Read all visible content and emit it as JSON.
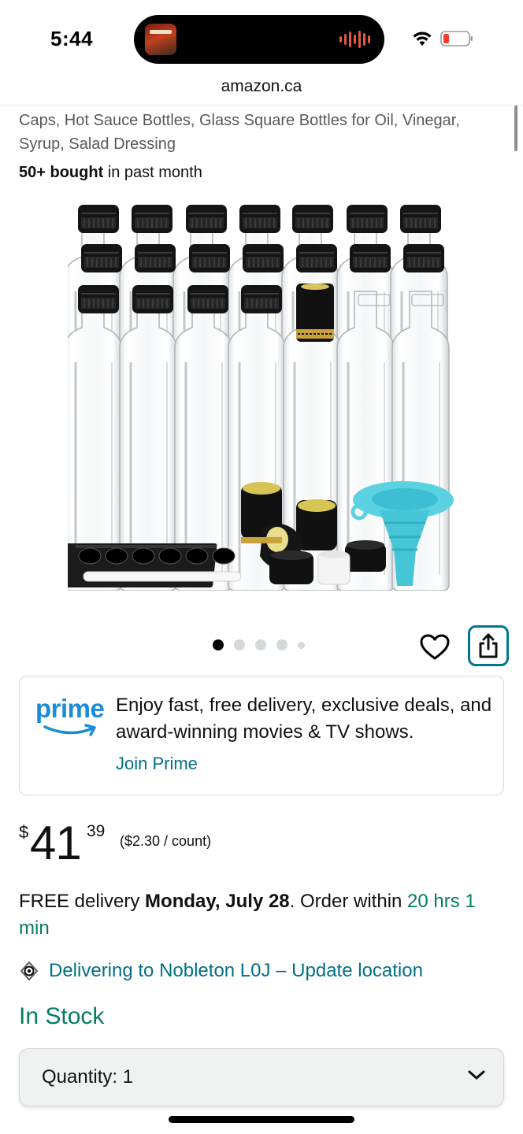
{
  "status_bar": {
    "time": "5:44",
    "icons": [
      "now-playing-art",
      "audio-waveform",
      "wifi-icon",
      "battery-low-icon"
    ]
  },
  "browser": {
    "domain": "amazon.ca"
  },
  "product": {
    "title_tail": "Caps, Hot Sauce Bottles, Glass Square Bottles for Oil, Vinegar, Syrup, Salad Dressing",
    "bought_count": "50+ bought",
    "bought_suffix": " in past month",
    "image_alt": "Glass square bottles with black caps, shrink capsules, labels, chalk marker and blue funnel",
    "carousel": {
      "total_images": 5,
      "active_index": 0
    }
  },
  "prime": {
    "logo_text": "prime",
    "message": "Enjoy fast, free delivery, exclusive deals, and award-winning movies & TV shows.",
    "link": "Join Prime"
  },
  "price": {
    "symbol": "$",
    "whole": "41",
    "fraction": "39",
    "unit_price": "($2.30 / count)"
  },
  "delivery": {
    "prefix": "FREE delivery ",
    "date": "Monday, July 28",
    "middle": ". Order within ",
    "countdown": "20 hrs 1 min"
  },
  "location": {
    "text": "Delivering to Nobleton L0J – Update location"
  },
  "stock": {
    "status": "In Stock"
  },
  "quantity": {
    "label": "Quantity:",
    "value": "1"
  },
  "colors": {
    "link": "#007185",
    "success": "#067d62",
    "prime_blue": "#1a8cd8",
    "share_border": "#00778d"
  }
}
